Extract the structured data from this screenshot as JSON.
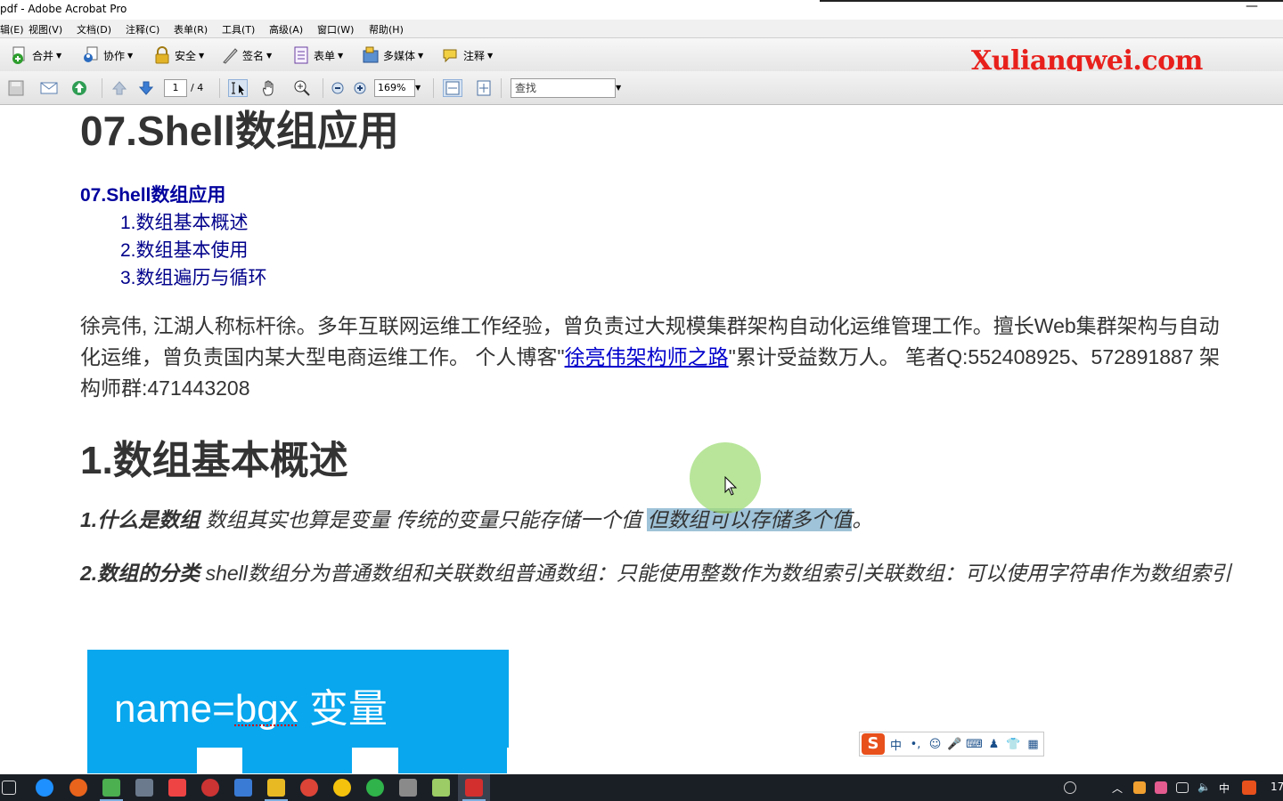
{
  "window": {
    "title": "pdf - Adobe Acrobat Pro",
    "minimize": "—"
  },
  "menu": [
    "辑(E)",
    "视图(V)",
    "文档(D)",
    "注释(C)",
    "表单(R)",
    "工具(T)",
    "高级(A)",
    "窗口(W)",
    "帮助(H)"
  ],
  "toolbar": {
    "merge": "合并",
    "collab": "协作",
    "security": "安全",
    "sign": "签名",
    "forms": "表单",
    "multimedia": "多媒体",
    "comment": "注释"
  },
  "brand": "Xuliangwei.com",
  "nav": {
    "page": "1",
    "total": "/ 4",
    "zoom": "169%",
    "find_placeholder": "查找"
  },
  "doc": {
    "title": "07.Shell数组应用",
    "toc_main": "07.Shell数组应用",
    "toc": [
      "1.数组基本概述",
      "2.数组基本使用",
      "3.数组遍历与循环"
    ],
    "intro_a": "徐亮伟, 江湖人称标杆徐。多年互联网运维工作经验，曾负责过大规模集群架构自动化运维管理工作。擅长Web集群架构与自动化运维，曾负责国内某大型电商运维工作。 个人博客\"",
    "intro_link": "徐亮伟架构师之路",
    "intro_b": "\"累计受益数万人。 笔者Q:552408925、572891887 架构师群:471443208",
    "h2": "1.数组基本概述",
    "p1_bold": "1.什么是数组",
    "p1_text": " 数组其实也算是变量 传统的变量只能存储一个值 ",
    "p1_hl": "但数组可以存储多个值",
    "p1_end": "。",
    "p2_bold": "2.数组的分类",
    "p2_text": " shell数组分为普通数组和关联数组普通数组：只能使用整数作为数组索引关联数组：可以使用字符串作为数组索引",
    "diagram_label": "name=bgx  变量"
  },
  "ime": {
    "logo": "S",
    "mode": "中",
    "punct": "•,",
    "emoji": "☺",
    "mic": "🎤",
    "kbd": "⌨",
    "user": "♟",
    "shirt": "👕",
    "grid": "▦"
  },
  "tray": {
    "ime": "中",
    "time": "17"
  }
}
